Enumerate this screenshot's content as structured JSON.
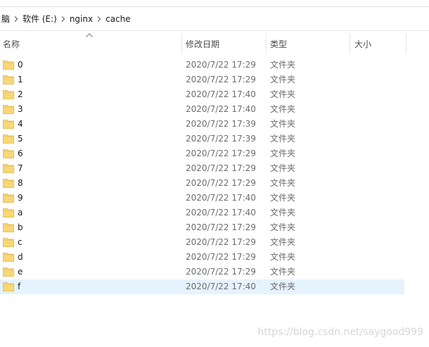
{
  "breadcrumb": {
    "items": [
      "脑",
      "软件 (E:)",
      "nginx",
      "cache"
    ]
  },
  "columns": {
    "name": "名称",
    "date": "修改日期",
    "type": "类型",
    "size": "大小"
  },
  "files": [
    {
      "name": "0",
      "date": "2020/7/22 17:29",
      "type": "文件夹"
    },
    {
      "name": "1",
      "date": "2020/7/22 17:29",
      "type": "文件夹"
    },
    {
      "name": "2",
      "date": "2020/7/22 17:40",
      "type": "文件夹"
    },
    {
      "name": "3",
      "date": "2020/7/22 17:40",
      "type": "文件夹"
    },
    {
      "name": "4",
      "date": "2020/7/22 17:39",
      "type": "文件夹"
    },
    {
      "name": "5",
      "date": "2020/7/22 17:39",
      "type": "文件夹"
    },
    {
      "name": "6",
      "date": "2020/7/22 17:29",
      "type": "文件夹"
    },
    {
      "name": "7",
      "date": "2020/7/22 17:29",
      "type": "文件夹"
    },
    {
      "name": "8",
      "date": "2020/7/22 17:29",
      "type": "文件夹"
    },
    {
      "name": "9",
      "date": "2020/7/22 17:40",
      "type": "文件夹"
    },
    {
      "name": "a",
      "date": "2020/7/22 17:40",
      "type": "文件夹"
    },
    {
      "name": "b",
      "date": "2020/7/22 17:29",
      "type": "文件夹"
    },
    {
      "name": "c",
      "date": "2020/7/22 17:29",
      "type": "文件夹"
    },
    {
      "name": "d",
      "date": "2020/7/22 17:29",
      "type": "文件夹"
    },
    {
      "name": "e",
      "date": "2020/7/22 17:29",
      "type": "文件夹"
    },
    {
      "name": "f",
      "date": "2020/7/22 17:40",
      "type": "文件夹",
      "selected": true
    }
  ],
  "icons": {
    "folder": "folder-icon",
    "separator": "chevron-right-icon",
    "sort": "sort-ascending-icon"
  },
  "colors": {
    "folder_body": "#f8d775",
    "folder_tab": "#e8b94a",
    "selected_row": "#e5f3ff",
    "secondary_text": "#6d6d6d"
  },
  "watermark": "https://blog.csdn.net/saygood999"
}
